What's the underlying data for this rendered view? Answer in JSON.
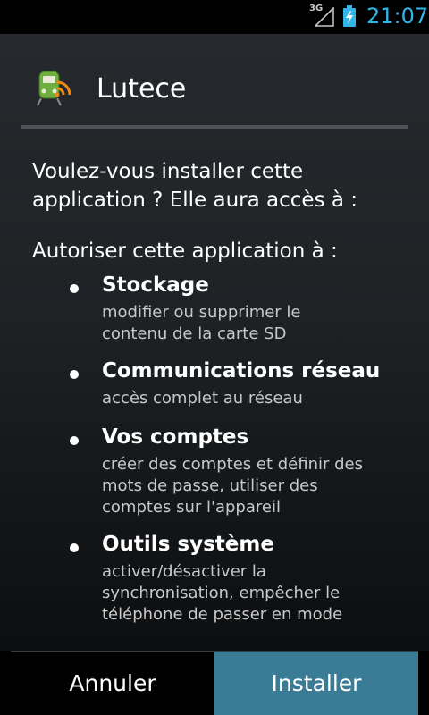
{
  "status_bar": {
    "network": "3G",
    "time": "21:07",
    "accent_color": "#33b5e5"
  },
  "dialog": {
    "app_name": "Lutece",
    "app_icon": "train-rss-icon",
    "prompt": "Voulez-vous installer cette application ? Elle aura accès à :",
    "allow_label": "Autoriser cette application à :",
    "permissions": [
      {
        "title": "Stockage",
        "desc": "modifier ou supprimer le contenu de la carte SD"
      },
      {
        "title": "Communications réseau",
        "desc": "accès complet au réseau"
      },
      {
        "title": "Vos comptes",
        "desc": "créer des comptes et définir des mots de passe, utiliser des comptes sur l'appareil"
      },
      {
        "title": "Outils système",
        "desc": "activer/désactiver la synchronisation, empêcher le téléphone de passer en mode"
      }
    ]
  },
  "buttons": {
    "cancel": "Annuler",
    "install": "Installer",
    "install_color": "#3a7b96"
  }
}
